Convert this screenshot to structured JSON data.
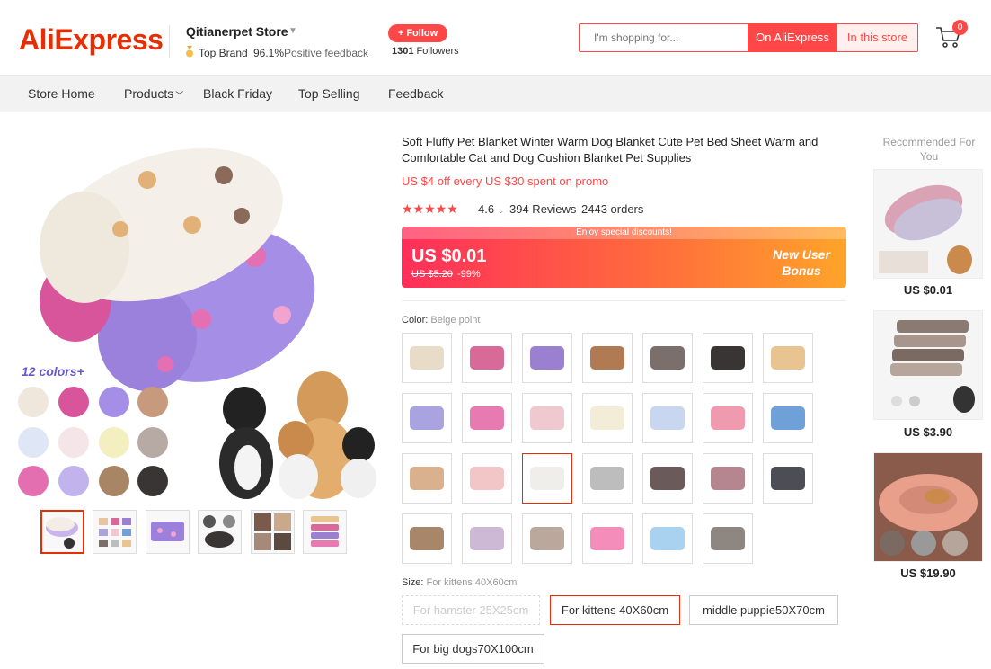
{
  "header": {
    "logo": "AliExpress",
    "store_name": "Qitianerpet Store",
    "top_brand": "Top Brand",
    "feedback_pct": "96.1%",
    "feedback_label": "Positive feedback",
    "follow_label": "+ Follow",
    "followers_count": "1301",
    "followers_label": "Followers",
    "search_placeholder": "I'm shopping for...",
    "search_ali_label": "On AliExpress",
    "search_store_label": "In this store",
    "cart_count": "0"
  },
  "nav": {
    "items": [
      "Store Home",
      "Products",
      "Black Friday",
      "Top Selling",
      "Feedback"
    ]
  },
  "gallery": {
    "colors_badge": "12 colors+",
    "thumbnail_count": 6,
    "selected_thumbnail": 1
  },
  "product": {
    "title": "Soft Fluffy Pet Blanket Winter Warm Dog Blanket Cute Pet Bed Sheet Warm and Comfortable Cat and Dog Cushion Blanket Pet Supplies",
    "promo": "US $4 off every US $30 spent on promo",
    "stars": "★★★★★",
    "rating": "4.6",
    "reviews": "394 Reviews",
    "orders": "2443 orders",
    "price_banner": "Enjoy special discounts!",
    "price": "US $0.01",
    "original_price": "US $5.20",
    "discount": "-99%",
    "bonus_line1": "New User",
    "bonus_line2": "Bonus",
    "color_label": "Color:",
    "color_value": "Beige point",
    "swatch_colors": [
      "#e8dcc8",
      "#d86a9a",
      "#9b7fd0",
      "#b07a52",
      "#7a6f6a",
      "#3a3535",
      "#e8c590",
      "#a9a4e0",
      "#e77ab0",
      "#f0c8d0",
      "#f3ecd6",
      "#c8d6ef",
      "#f09ab0",
      "#6fa0d8",
      "#d9b18e",
      "#f2c6c6",
      "#efeeea",
      "#bdbdbd",
      "#6a5a5a",
      "#b5868f",
      "#4d4d55",
      "#a8866a",
      "#cdb8d6",
      "#bba89c",
      "#f58dbb",
      "#a8d2ef",
      "#8e8680"
    ],
    "selected_swatch": 16,
    "size_label": "Size:",
    "size_value": "For kittens 40X60cm",
    "sizes": [
      "For hamster 25X25cm",
      "For kittens 40X60cm",
      "middle puppie50X70cm",
      "For big dogs70X100cm"
    ]
  },
  "recommended": {
    "title": "Recommended For You",
    "items": [
      {
        "price": "US $0.01"
      },
      {
        "price": "US $3.90"
      },
      {
        "price": "US $19.90"
      }
    ]
  },
  "colors": {
    "brand": "#e62e04",
    "accent": "#ff4747"
  }
}
